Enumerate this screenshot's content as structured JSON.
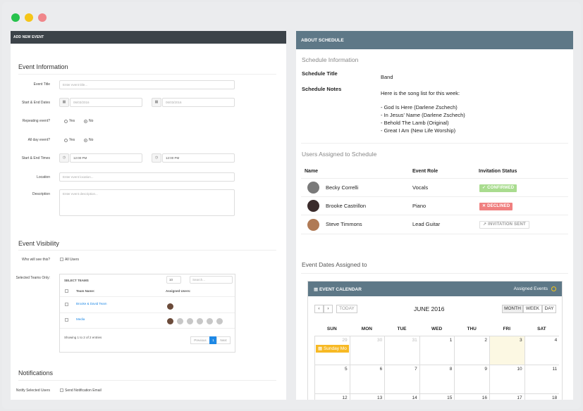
{
  "window": {
    "dot_colors": [
      "#27c24c",
      "#f5c518",
      "#f0868a"
    ]
  },
  "left": {
    "header": "ADD NEW EVENT",
    "event_info_title": "Event Information",
    "event_title_label": "Event Title",
    "event_title_placeholder": "Enter event title...",
    "dates_label": "Start & End Dates",
    "start_date": "06/03/2016",
    "end_date": "06/03/2016",
    "repeating_label": "Repeating event?",
    "yes": "Yes",
    "no": "No",
    "allday_label": "All day event?",
    "times_label": "Start & End Times",
    "start_time": "12:00 PM",
    "end_time": "12:00 PM",
    "location_label": "Location",
    "location_placeholder": "Enter event location...",
    "description_label": "Description",
    "description_placeholder": "Enter event description...",
    "visibility_title": "Event Visibility",
    "who_label": "Who will see this?",
    "all_users": "All Users",
    "teams_label": "Selected Teams Only:",
    "teams_table": {
      "select_label": "SELECT TEAMS",
      "page_size": "10",
      "search_placeholder": "Search...",
      "col_team": "Team Name:",
      "col_users": "Assigned Users:",
      "rows": [
        "Brooke & David Team",
        "Media"
      ],
      "info": "Showing 1 to 2 of 2 entries",
      "prev": "Previous",
      "page": "1",
      "next": "Next"
    },
    "notifications_title": "Notifications",
    "notify_label": "Notify Selected Users",
    "send_email": "Send Notification Email"
  },
  "right": {
    "header": "ABOUT SCHEDULE",
    "schedule_info_title": "Schedule Information",
    "schedule_title_label": "Schedule Title",
    "schedule_title_value": "Band",
    "notes_label": "Schedule Notes",
    "notes_lines": [
      "Here is the song list for this week:",
      "",
      "- God Is Here (Darlene Zschech)",
      "- In Jesus' Name (Darlene Zschech)",
      "- Behold The Lamb (Original)",
      "- Great I Am (New Life Worship)"
    ],
    "users_title": "Users Assigned to Schedule",
    "cols": {
      "name": "Name",
      "role": "Event Role",
      "status": "Invitation Status"
    },
    "users": [
      {
        "name": "Becky Correlli",
        "role": "Vocals",
        "status": "CONFIRMED",
        "status_icon": "check-icon"
      },
      {
        "name": "Brooke Castrillon",
        "role": "Piano",
        "status": "DECLINED",
        "status_icon": "close-icon"
      },
      {
        "name": "Steve Timmons",
        "role": "Lead Guitar",
        "status": "INVITATION SENT",
        "status_icon": "arrow-icon"
      }
    ],
    "status_colors": {
      "confirmed": "#a9dc8f",
      "declined": "#f08080",
      "sent": "#ffffff"
    },
    "dates_title": "Event Dates Assigned to",
    "calendar": {
      "header": "EVENT CALENDAR",
      "assigned": "Assigned Events",
      "today": "TODAY",
      "month_title": "JUNE 2016",
      "views": [
        "MONTH",
        "WEEK",
        "DAY"
      ],
      "dows": [
        "SUN",
        "MON",
        "TUE",
        "WED",
        "THU",
        "FRI",
        "SAT"
      ],
      "weeks": [
        [
          "29",
          "30",
          "31",
          "1",
          "2",
          "3",
          "4"
        ],
        [
          "5",
          "6",
          "7",
          "8",
          "9",
          "10",
          "11"
        ],
        [
          "12",
          "13",
          "14",
          "15",
          "16",
          "17",
          "18"
        ]
      ],
      "event_label": "Sunday Mo",
      "event_color": "#f7b924",
      "today_color": "#fcf8e3"
    }
  }
}
